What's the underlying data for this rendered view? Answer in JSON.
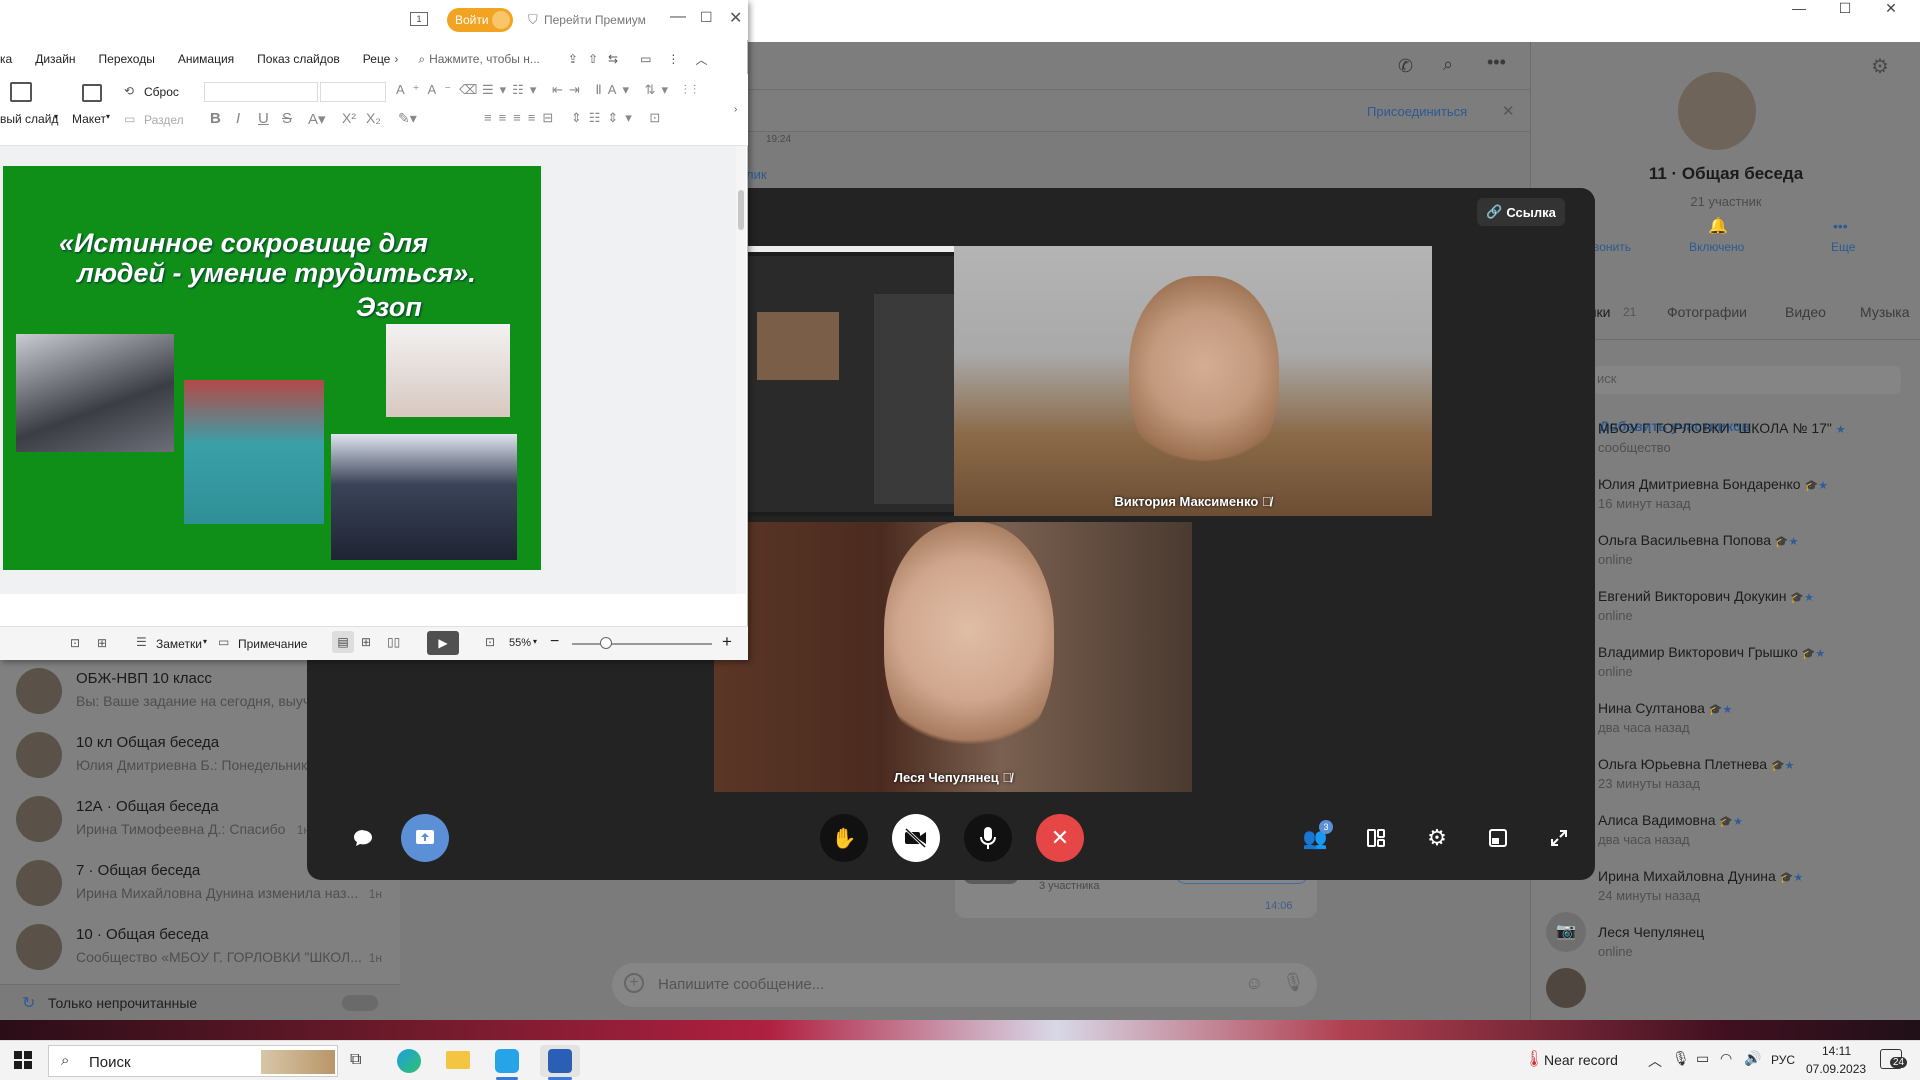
{
  "messenger": {
    "chats": [
      {
        "title": "ОБЖ-НВП 10 класс",
        "subtitle": "Вы: Ваше задание на сегодня, выуч",
        "time": ""
      },
      {
        "title": "10 кл Общая беседа",
        "subtitle": "Юлия Дмитриевна Б.: Понедельник",
        "time": ""
      },
      {
        "title": "12А · Общая беседа",
        "subtitle": "Ирина Тимофеевна Д.: Спасибо",
        "time": "1н"
      },
      {
        "title": "7 · Общая беседа",
        "subtitle": "Ирина Михайловна Дунина изменила наз...",
        "time": "1н"
      },
      {
        "title": "10 · Общая беседа",
        "subtitle": "Сообщество «МБОУ Г. ГОРЛОВКИ \"ШКОЛ...",
        "time": "1н"
      }
    ],
    "unread_only": "Только непрочитанные",
    "join_label": "Присоединиться",
    "time_1924": "19:24",
    "snippet": "лик",
    "composer_placeholder": "Напишите сообщение...",
    "bottom_join": "Присоединиться",
    "bottom_count": "3 участника",
    "bottom_time": "14:06",
    "group": {
      "title": "11 · Общая беседа",
      "count": "21 участник",
      "actions": [
        "вонить",
        "Включено",
        "Еще"
      ],
      "tabs": [
        "ники",
        "21",
        "Фотографии",
        "Видео",
        "Музыка"
      ],
      "search": "иск",
      "add_members": "Добавить участников",
      "members": [
        {
          "name": "МБОУ Г. ГОРЛОВКИ \"ШКОЛА № 17\"",
          "sub": "сообщество"
        },
        {
          "name": "Юлия Дмитриевна Бондаренко",
          "sub": "16 минут назад"
        },
        {
          "name": "Ольга Васильевна Попова",
          "sub": "online"
        },
        {
          "name": "Евгений Викторович Докукин",
          "sub": "online"
        },
        {
          "name": "Владимир Викторович Грышко",
          "sub": "online"
        },
        {
          "name": "Нина Султанова",
          "sub": "два часа назад"
        },
        {
          "name": "Ольга Юрьевна Плетнева",
          "sub": "23 минуты назад"
        },
        {
          "name": "Алиса Вадимовна",
          "sub": "два часа назад"
        },
        {
          "name": "Ирина Михайловна Дунина",
          "sub": "24 минуты назад"
        },
        {
          "name": "Леся Чепулянец",
          "sub": "online"
        }
      ]
    }
  },
  "call": {
    "link_label": "Ссылка",
    "participants": [
      {
        "name": "Виктория Максименко"
      },
      {
        "name": "Леся Чепулянец"
      }
    ],
    "participant_badge": "3"
  },
  "wps": {
    "login": "Войти",
    "premium": "Перейти Премиум",
    "tabs": [
      "ка",
      "Дизайн",
      "Переходы",
      "Анимация",
      "Показ слайдов",
      "Реце"
    ],
    "search": "Нажмите, чтобы н...",
    "ribbon": {
      "reset": "Сброс",
      "new_slide": "вый слайд",
      "layout": "Макет",
      "section": "Раздел"
    },
    "slide": {
      "line1": "«Истинное сокровище для",
      "line2": "людей - умение трудиться».",
      "author": "Эзоп"
    },
    "status": {
      "notes": "Заметки",
      "comment": "Примечание",
      "zoom": "55%"
    }
  },
  "taskbar": {
    "search": "Поиск",
    "weather": "Near record",
    "lang": "РУС",
    "time": "14:11",
    "date": "07.09.2023",
    "notif": "24"
  }
}
